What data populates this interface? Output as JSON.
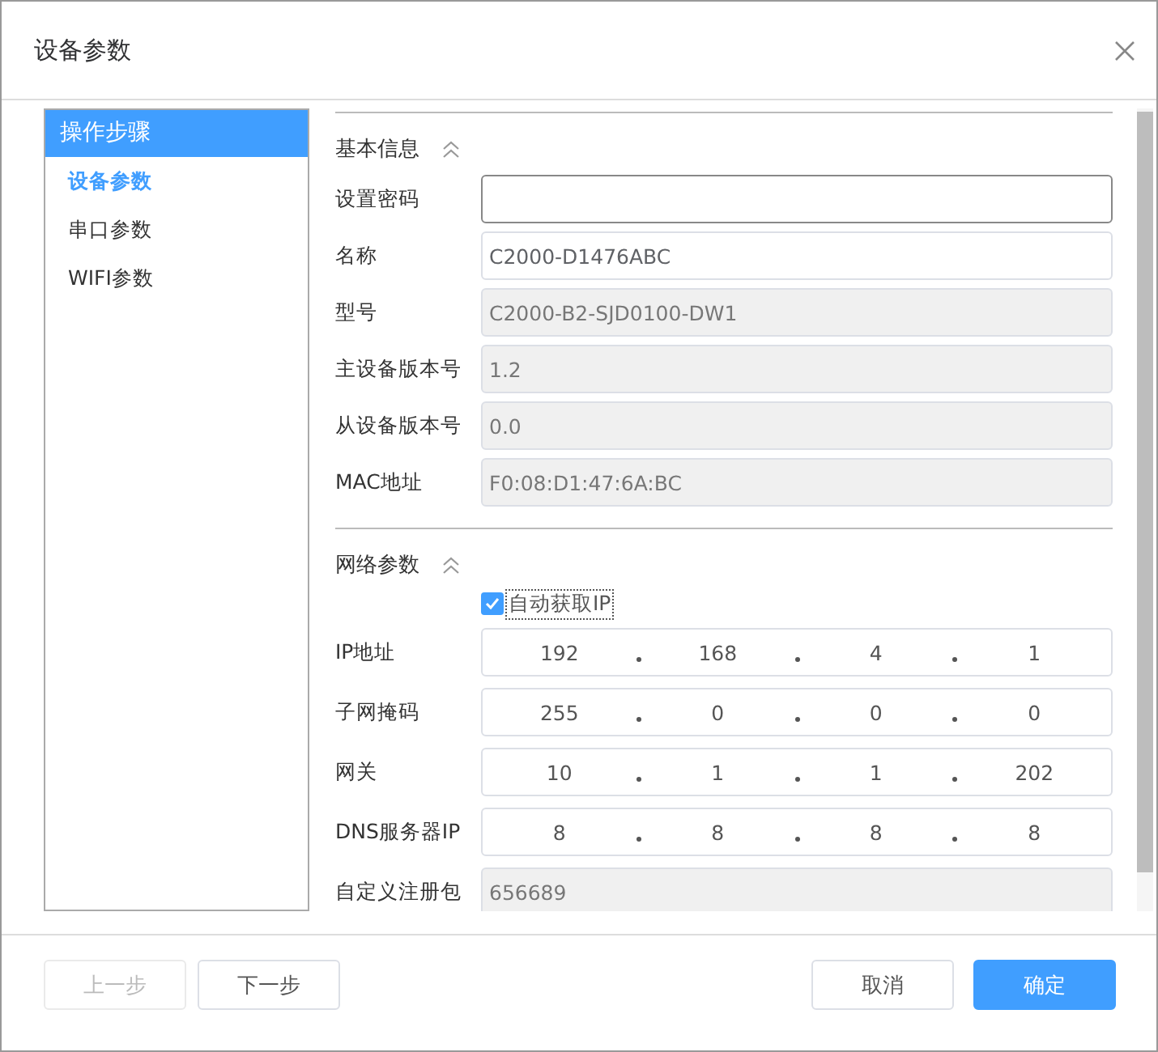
{
  "dialog": {
    "title": "设备参数"
  },
  "steps": {
    "header": "操作步骤",
    "items": [
      {
        "label": "设备参数",
        "selected": true
      },
      {
        "label": "串口参数",
        "selected": false
      },
      {
        "label": "WIFI参数",
        "selected": false
      }
    ]
  },
  "sections": [
    {
      "title": "基本信息",
      "expanded": true,
      "fields": [
        {
          "kind": "input",
          "label": "设置密码",
          "focused": true
        },
        {
          "kind": "input",
          "label": "名称",
          "value": "C2000-D1476ABC",
          "focused": false
        },
        {
          "kind": "readonly",
          "label": "型号",
          "value": "C2000-B2-SJD0100-DW1"
        },
        {
          "kind": "readonly",
          "label": "主设备版本号",
          "value": "1.2"
        },
        {
          "kind": "readonly",
          "label": "从设备版本号",
          "value": "0.0"
        },
        {
          "kind": "readonly",
          "label": "MAC地址",
          "value": "F0:08:D1:47:6A:BC"
        }
      ]
    },
    {
      "title": "网络参数",
      "expanded": true,
      "fields": [
        {
          "kind": "checkbox",
          "label": "自动获取IP",
          "checked": true
        },
        {
          "kind": "ip",
          "label": "IP地址",
          "octets": [
            "192",
            "168",
            "4",
            "1"
          ]
        },
        {
          "kind": "ip",
          "label": "子网掩码",
          "octets": [
            "255",
            "0",
            "0",
            "0"
          ]
        },
        {
          "kind": "ip",
          "label": "网关",
          "octets": [
            "10",
            "1",
            "1",
            "202"
          ]
        },
        {
          "kind": "ip",
          "label": "DNS服务器IP",
          "octets": [
            "8",
            "8",
            "8",
            "8"
          ]
        },
        {
          "kind": "readonly",
          "label": "自定义注册包",
          "value": "656689"
        }
      ]
    }
  ],
  "footer": {
    "left": [
      {
        "label": "上一步",
        "disabled": true
      },
      {
        "label": "下一步",
        "disabled": false
      }
    ],
    "right": [
      {
        "label": "取消",
        "kind": "default"
      },
      {
        "label": "确定",
        "kind": "primary"
      }
    ]
  }
}
